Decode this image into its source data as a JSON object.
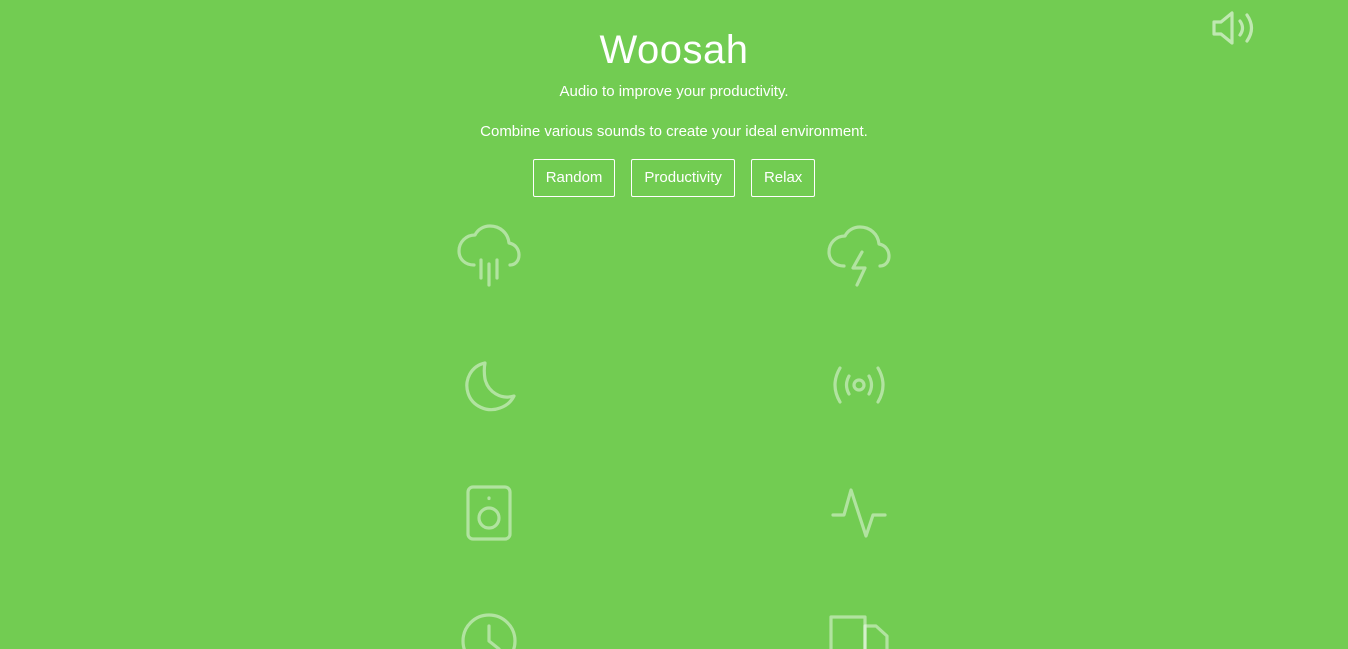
{
  "app": {
    "title": "Woosah",
    "subtitle": "Audio to improve your productivity.",
    "description": "Combine various sounds to create your ideal environment."
  },
  "presets": [
    {
      "label": "Random"
    },
    {
      "label": "Productivity"
    },
    {
      "label": "Relax"
    }
  ],
  "volume_icon": "volume-icon",
  "sounds": [
    {
      "icon": "rain-cloud-icon"
    },
    {
      "icon": "thunderstorm-icon"
    },
    {
      "icon": "moon-icon"
    },
    {
      "icon": "broadcast-icon"
    },
    {
      "icon": "speaker-icon"
    },
    {
      "icon": "activity-icon"
    },
    {
      "icon": "clock-icon"
    },
    {
      "icon": "truck-icon"
    }
  ],
  "colors": {
    "background": "#72cc52",
    "text": "#ffffff",
    "icon_inactive": "rgba(255,255,255,0.45)"
  }
}
